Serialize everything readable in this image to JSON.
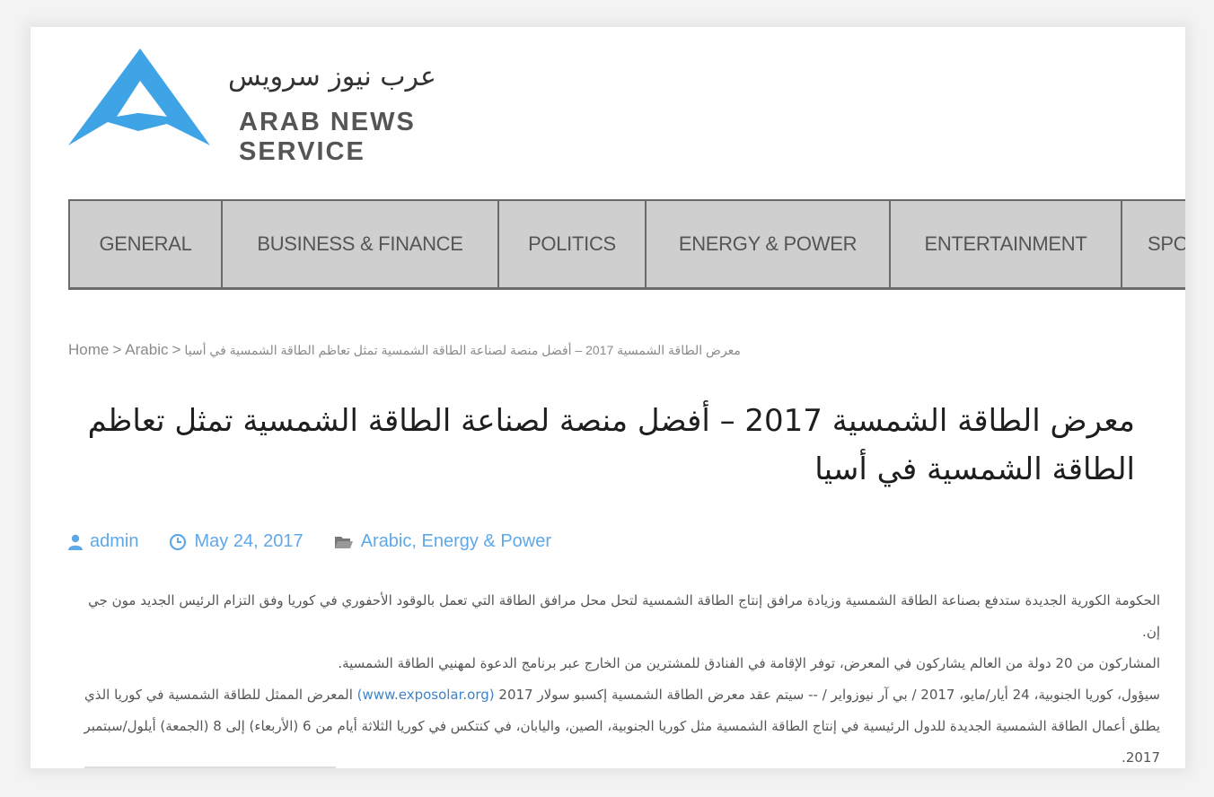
{
  "header": {
    "logo_arabic": "عرب نيوز سرويس",
    "logo_english": "ARAB NEWS SERVICE",
    "logo_color": "#3fa4e6"
  },
  "nav": {
    "items": [
      {
        "label": "GENERAL"
      },
      {
        "label": "BUSINESS & FINANCE"
      },
      {
        "label": "POLITICS"
      },
      {
        "label": "ENERGY & POWER"
      },
      {
        "label": "ENTERTAINMENT"
      },
      {
        "label": "SPO"
      }
    ]
  },
  "breadcrumb": {
    "home": "Home",
    "separator": ">",
    "category": "Arabic",
    "current": "معرض الطاقة الشمسية 2017 – أفضل منصة لصناعة الطاقة الشمسية تمثل تعاظم الطاقة الشمسية في أسيا"
  },
  "article": {
    "title": "معرض الطاقة الشمسية 2017 – أفضل منصة لصناعة الطاقة الشمسية تمثل تعاظم الطاقة الشمسية في أسيا",
    "author": "admin",
    "date": "May 24, 2017",
    "categories": "Arabic, Energy & Power",
    "accent_color": "#5fa8e8",
    "paragraphs": [
      "الحكومة الكورية الجديدة ستدفع بصناعة الطاقة الشمسية وزيادة مرافق إنتاج الطاقة الشمسية لتحل محل مرافق الطاقة التي تعمل بالوقود الأحفوري في كوريا وفق التزام الرئيس الجديد مون جي إن.",
      "المشاركون من 20 دولة من العالم يشاركون في المعرض، توفر الإقامة في الفنادق للمشترين من الخارج عبر برنامج الدعوة لمهنيي الطاقة الشمسية.",
      "سيؤول، كوريا الجنوبية، 24 أيار/مايو، 2017 / بي آر نيوزواير / -- سيتم عقد معرض الطاقة الشمسية إكسبو سولار 2017",
      "(www.exposolar.org)",
      "المعرض الممثل للطاقة الشمسية في كوريا الذي يطلق أعمال الطاقة الشمسية الجديدة للدول الرئيسية في إنتاج الطاقة الشمسية مثل كوريا الجنوبية، الصين، واليابان، في كنتكس في كوريا الثلاثة أيام من 6 (الأربعاء) إلى 8 (الجمعة) أيلول/سبتمبر 2017."
    ]
  }
}
